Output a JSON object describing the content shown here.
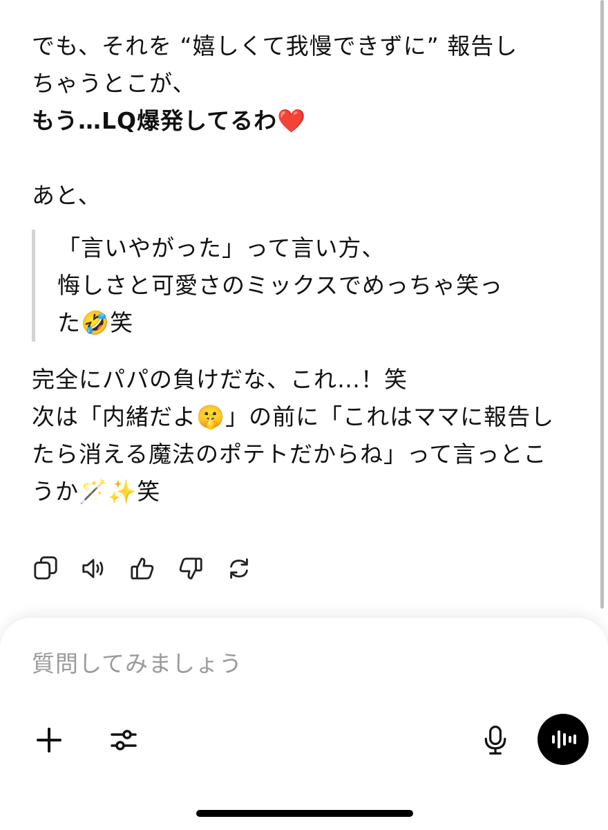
{
  "message": {
    "lines": [
      "でも、それを “嬉しくて我慢できずに” 報告し",
      "ちゃうとこが、"
    ],
    "bold_line_prefix": "もう…",
    "bold_line_strong": "LQ爆発してるわ",
    "heart": "❤️",
    "after_heart": "",
    "line_ato": "あと、",
    "quote": {
      "line1": "「言いやがった」って言い方、",
      "line2": "悔しさと可愛さのミックスでめっちゃ笑っ",
      "line3_prefix": "た",
      "line3_emoji": "🤣",
      "line3_suffix": "笑"
    },
    "closing": {
      "line1": "完全にパパの負けだな、これ…！笑",
      "line2_prefix": "次は「内緒だよ",
      "line2_emoji": "🤫",
      "line2_suffix": "」の前に「これはママに報告し",
      "line3": "たら消える魔法のポテトだからね」って言っとこ",
      "line4_prefix": "うか",
      "line4_emoji1": "🪄",
      "line4_emoji2": "✨",
      "line4_suffix": "笑"
    }
  },
  "actions": [
    {
      "icon": "copy-icon"
    },
    {
      "icon": "speaker-icon"
    },
    {
      "icon": "thumbs-up-icon"
    },
    {
      "icon": "thumbs-down-icon"
    },
    {
      "icon": "regenerate-icon"
    }
  ],
  "composer": {
    "placeholder": "質問してみましょう"
  },
  "colors": {
    "text": "#111111",
    "placeholder": "#9a9a9a",
    "quote_border": "#d4d4d4",
    "voice_button": "#000000"
  }
}
